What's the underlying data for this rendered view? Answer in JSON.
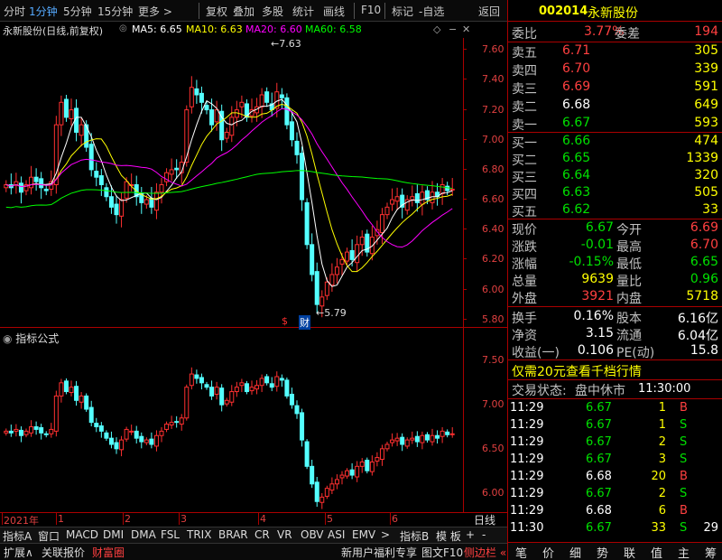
{
  "toolbar": {
    "items": [
      "分时",
      "1分钟",
      "5分钟",
      "15分钟",
      "更多 >",
      "复权",
      "叠加",
      "多股",
      "统计",
      "画线",
      "F10",
      "标记",
      "-自选",
      "返回"
    ]
  },
  "chart_title": {
    "name": "永新股份(日线,前复权)",
    "ma5": "MA5: 6.65",
    "ma10": "MA10: 6.63",
    "ma20": "MA20: 6.60",
    "ma60": "MA60: 6.58",
    "high_mark": "7.63",
    "low_mark": "5.79",
    "events": [
      "$",
      "财"
    ]
  },
  "indicator_title": "指标公式",
  "colors": {
    "ma5": "#ffffff",
    "ma10": "#ffff00",
    "ma20": "#ff00ff",
    "ma60": "#00ff00",
    "up": "#ff3030",
    "down": "#54ffff",
    "border": "#aa0000"
  },
  "chart_data": [
    {
      "type": "candlestick",
      "title": "永新股份(日线,前复权)",
      "y_ticks": [
        "7.60",
        "7.40",
        "7.20",
        "7.00",
        "6.80",
        "6.60",
        "6.40",
        "6.20",
        "6.00",
        "5.80"
      ],
      "ylim": [
        5.75,
        7.68
      ],
      "x_ticks": [
        "2021年",
        "1",
        "2",
        "3",
        "4",
        "5",
        "6"
      ],
      "series": [
        {
          "name": "MA5",
          "last": 6.65
        },
        {
          "name": "MA10",
          "last": 6.63
        },
        {
          "name": "MA20",
          "last": 6.6
        },
        {
          "name": "MA60",
          "last": 6.58
        }
      ],
      "closes": [
        6.7,
        6.68,
        6.72,
        6.65,
        6.7,
        6.75,
        6.72,
        6.68,
        6.66,
        6.72,
        7.1,
        7.25,
        7.15,
        7.2,
        7.05,
        7.1,
        6.95,
        6.8,
        6.75,
        6.7,
        6.62,
        6.55,
        6.5,
        6.6,
        6.72,
        6.7,
        6.62,
        6.58,
        6.6,
        6.55,
        6.65,
        6.7,
        6.78,
        6.8,
        6.8,
        6.85,
        7.2,
        7.35,
        7.3,
        7.25,
        7.2,
        7.1,
        7.2,
        7.0,
        7.05,
        7.15,
        7.2,
        7.25,
        7.15,
        7.2,
        7.22,
        7.3,
        7.25,
        7.2,
        7.32,
        7.28,
        7.1,
        7.0,
        6.9,
        6.6,
        6.3,
        6.1,
        5.9,
        5.95,
        6.05,
        6.1,
        6.15,
        6.2,
        6.25,
        6.2,
        6.3,
        6.35,
        6.25,
        6.35,
        6.4,
        6.5,
        6.55,
        6.6,
        6.62,
        6.55,
        6.6,
        6.62,
        6.58,
        6.65,
        6.6,
        6.65,
        6.62,
        6.7,
        6.66,
        6.67
      ]
    },
    {
      "type": "candlestick",
      "title": "指标公式",
      "y_ticks": [
        "7.50",
        "7.00",
        "6.50",
        "6.00"
      ],
      "ylim": [
        5.8,
        7.7
      ]
    }
  ],
  "bottom_tabs": [
    "指标A",
    "窗口",
    "MACD",
    "DMI",
    "DMA",
    "FSL",
    "TRIX",
    "BRAR",
    "CR",
    "VR",
    "OBV",
    "ASI",
    "EMV",
    ">",
    "指标B",
    "模 板",
    "+",
    "-",
    "日线"
  ],
  "footer": [
    "扩展∧",
    "关联报价",
    "财富圈",
    "新用户福利专享",
    "图文F10",
    "侧边栏 «"
  ],
  "quote": {
    "code": "002014",
    "name": "永新股份",
    "weibi_label": "委比",
    "weibi": "3.77%",
    "weicha_label": "委差",
    "weicha": "194",
    "sell": [
      {
        "label": "卖五",
        "price": "6.71",
        "vol": "305"
      },
      {
        "label": "卖四",
        "price": "6.70",
        "vol": "339"
      },
      {
        "label": "卖三",
        "price": "6.69",
        "vol": "591"
      },
      {
        "label": "卖二",
        "price": "6.68",
        "vol": "649"
      },
      {
        "label": "卖一",
        "price": "6.67",
        "vol": "593"
      }
    ],
    "buy": [
      {
        "label": "买一",
        "price": "6.66",
        "vol": "474"
      },
      {
        "label": "买二",
        "price": "6.65",
        "vol": "1339"
      },
      {
        "label": "买三",
        "price": "6.64",
        "vol": "320"
      },
      {
        "label": "买四",
        "price": "6.63",
        "vol": "505"
      },
      {
        "label": "买五",
        "price": "6.62",
        "vol": "33"
      }
    ],
    "stats": [
      {
        "l1": "现价",
        "v1": "6.67",
        "l2": "今开",
        "v2": "6.69"
      },
      {
        "l1": "涨跌",
        "v1": "-0.01",
        "l2": "最高",
        "v2": "6.70"
      },
      {
        "l1": "涨幅",
        "v1": "-0.15%",
        "l2": "最低",
        "v2": "6.65"
      },
      {
        "l1": "总量",
        "v1": "9639",
        "l2": "量比",
        "v2": "0.96"
      },
      {
        "l1": "外盘",
        "v1": "3921",
        "l2": "内盘",
        "v2": "5718"
      }
    ],
    "finance": [
      {
        "l1": "换手",
        "v1": "0.16%",
        "l2": "股本",
        "v2": "6.16亿"
      },
      {
        "l1": "净资",
        "v1": "3.15",
        "l2": "流通",
        "v2": "6.04亿"
      },
      {
        "l1": "收益(一)",
        "v1": "0.106",
        "l2": "PE(动)",
        "v2": "15.8"
      }
    ],
    "promo": "仅需20元查看千档行情",
    "status_label": "交易状态:",
    "status": "盘中休市",
    "status_time": "11:30:00",
    "ticks": [
      {
        "t": "11:29",
        "p": "6.67",
        "v": "1",
        "d": "B"
      },
      {
        "t": "11:29",
        "p": "6.67",
        "v": "1",
        "d": "S"
      },
      {
        "t": "11:29",
        "p": "6.67",
        "v": "2",
        "d": "S"
      },
      {
        "t": "11:29",
        "p": "6.67",
        "v": "3",
        "d": "S"
      },
      {
        "t": "11:29",
        "p": "6.68",
        "v": "20",
        "d": "B"
      },
      {
        "t": "11:29",
        "p": "6.67",
        "v": "2",
        "d": "S"
      },
      {
        "t": "11:29",
        "p": "6.68",
        "v": "6",
        "d": "B"
      },
      {
        "t": "11:30",
        "p": "6.67",
        "v": "33",
        "d": "S",
        "n": "29"
      }
    ],
    "nav": [
      "笔",
      "价",
      "细",
      "势",
      "联",
      "值",
      "主",
      "筹"
    ]
  }
}
